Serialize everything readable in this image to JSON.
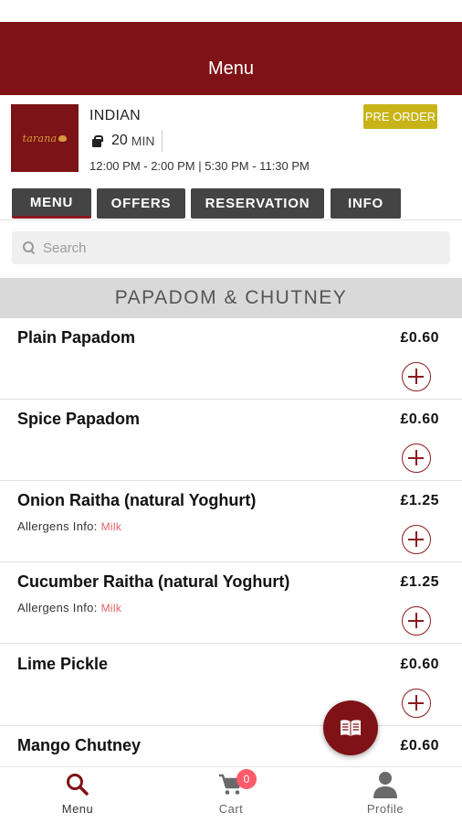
{
  "app": {
    "title": "Menu"
  },
  "restaurant": {
    "logo_text": "tarana",
    "cuisine": "INDIAN",
    "delivery_time": "20",
    "delivery_unit": "MIN",
    "hours": "12:00 PM - 2:00 PM | 5:30 PM - 11:30 PM",
    "preorder_label": "PRE ORDER"
  },
  "tabs": [
    {
      "label": "MENU",
      "active": true
    },
    {
      "label": "OFFERS",
      "active": false
    },
    {
      "label": "RESERVATION",
      "active": false
    },
    {
      "label": "INFO",
      "active": false
    }
  ],
  "search": {
    "placeholder": "Search",
    "value": ""
  },
  "section": {
    "title": "PAPADOM & CHUTNEY"
  },
  "items": [
    {
      "name": "Plain Papadom",
      "price": "£0.60",
      "allergen_label": "",
      "allergen_value": ""
    },
    {
      "name": "Spice Papadom",
      "price": "£0.60",
      "allergen_label": "",
      "allergen_value": ""
    },
    {
      "name": "Onion Raitha (natural Yoghurt)",
      "price": "£1.25",
      "allergen_label": "Allergens Info:",
      "allergen_value": "Milk"
    },
    {
      "name": "Cucumber Raitha (natural Yoghurt)",
      "price": "£1.25",
      "allergen_label": "Allergens Info:",
      "allergen_value": "Milk"
    },
    {
      "name": "Lime Pickle",
      "price": "£0.60",
      "allergen_label": "",
      "allergen_value": ""
    },
    {
      "name": "Mango Chutney",
      "price": "£0.60",
      "allergen_label": "",
      "allergen_value": ""
    }
  ],
  "bottom_nav": [
    {
      "label": "Menu",
      "icon": "search-icon",
      "active": true
    },
    {
      "label": "Cart",
      "icon": "cart-icon",
      "badge": "0",
      "active": false
    },
    {
      "label": "Profile",
      "icon": "profile-icon",
      "active": false
    }
  ],
  "colors": {
    "brand": "#7f1216",
    "preorder": "#c8b418",
    "tab": "#444444",
    "allergen": "#e2626a",
    "badge": "#ff5a6b"
  }
}
